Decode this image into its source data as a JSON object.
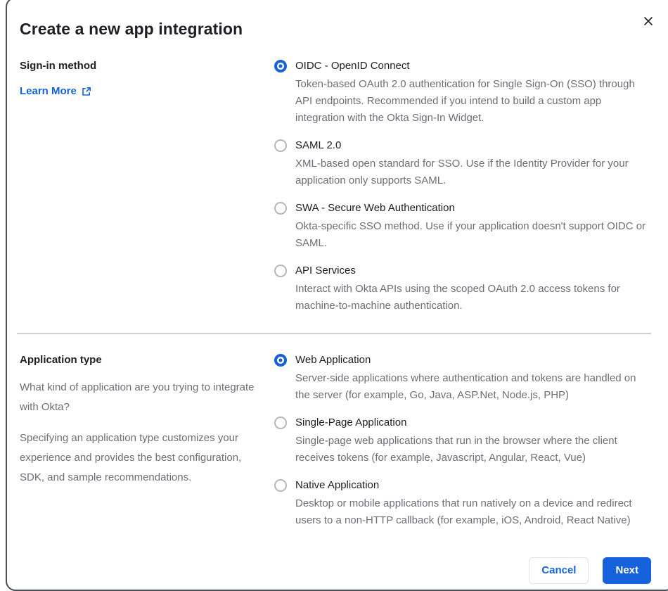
{
  "modal": {
    "title": "Create a new app integration"
  },
  "signin_section": {
    "label": "Sign-in method",
    "learn_more_label": "Learn More",
    "options": [
      {
        "label": "OIDC - OpenID Connect",
        "description": "Token-based OAuth 2.0 authentication for Single Sign-On (SSO) through API endpoints. Recommended if you intend to build a custom app integration with the Okta Sign-In Widget.",
        "selected": true
      },
      {
        "label": "SAML 2.0",
        "description": "XML-based open standard for SSO. Use if the Identity Provider for your application only supports SAML.",
        "selected": false
      },
      {
        "label": "SWA - Secure Web Authentication",
        "description": "Okta-specific SSO method. Use if your application doesn't support OIDC or SAML.",
        "selected": false
      },
      {
        "label": "API Services",
        "description": "Interact with Okta APIs using the scoped OAuth 2.0 access tokens for machine-to-machine authentication.",
        "selected": false
      }
    ]
  },
  "apptype_section": {
    "label": "Application type",
    "helper_1": "What kind of application are you trying to integrate with Okta?",
    "helper_2": "Specifying an application type customizes your experience and provides the best configuration, SDK, and sample recommendations.",
    "options": [
      {
        "label": "Web Application",
        "description": "Server-side applications where authentication and tokens are handled on the server (for example, Go, Java, ASP.Net, Node.js, PHP)",
        "selected": true
      },
      {
        "label": "Single-Page Application",
        "description": "Single-page web applications that run in the browser where the client receives tokens (for example, Javascript, Angular, React, Vue)",
        "selected": false
      },
      {
        "label": "Native Application",
        "description": "Desktop or mobile applications that run natively on a device and redirect users to a non-HTTP callback (for example, iOS, Android, React Native)",
        "selected": false
      }
    ]
  },
  "footer": {
    "cancel_label": "Cancel",
    "next_label": "Next"
  },
  "colors": {
    "accent_blue": "#1662dd",
    "text_dark": "#1d1f24",
    "text_gray": "#6e6e78",
    "divider": "#d0d0d5"
  }
}
